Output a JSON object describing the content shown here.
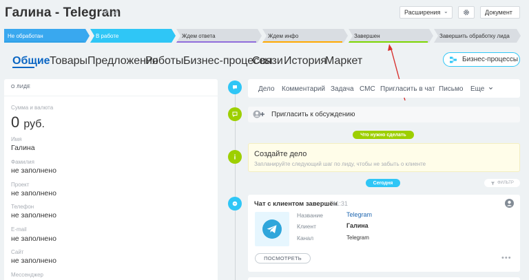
{
  "header": {
    "title": "Галина - Telegram",
    "extensions_label": "Расширения",
    "document_label": "Документ"
  },
  "stages": [
    {
      "label": "Не обработан",
      "color": "#39a8ef",
      "bar": "#2fa0e6"
    },
    {
      "label": "В работе",
      "color": "#2fc6f6",
      "bar": "#2fc6f6"
    },
    {
      "label": "Ждем ответа",
      "color": "#d9dde2",
      "bar": "#8f6cdb"
    },
    {
      "label": "Ждем инфо",
      "color": "#d9dde2",
      "bar": "#ffa900"
    },
    {
      "label": "Завершен",
      "color": "#d9dde2",
      "bar": "#7bd500"
    },
    {
      "label": "Завершить обработку лида",
      "color": "#d9dde2",
      "bar": "#d9dde2"
    }
  ],
  "tabs": [
    "Общие",
    "Товары",
    "Предложения",
    "Роботы",
    "Бизнес-процессы",
    "Связи",
    "История",
    "Маркет"
  ],
  "bp_button": "Бизнес-процессы",
  "lead": {
    "section_title": "О ЛИДЕ",
    "fields": [
      {
        "label": "Сумма и валюта",
        "value": "0",
        "unit": "руб."
      },
      {
        "label": "Имя",
        "value": "Галина"
      },
      {
        "label": "Фамилия",
        "value": "не заполнено"
      },
      {
        "label": "Проект",
        "value": "не заполнено"
      },
      {
        "label": "Телефон",
        "value": "не заполнено"
      },
      {
        "label": "E-mail",
        "value": "не заполнено"
      },
      {
        "label": "Сайт",
        "value": "не заполнено"
      },
      {
        "label": "Мессенджер",
        "value": ""
      }
    ]
  },
  "activity_menu": [
    "Дело",
    "Комментарий",
    "Задача",
    "СМС",
    "Пригласить в чат",
    "Письмо",
    "Еще"
  ],
  "invite": "Пригласить к обсуждению",
  "todo_pill": "Что нужно сделать",
  "create_task": {
    "title": "Создайте дело",
    "hint": "Запланируйте следующий шаг по лиду, чтобы не забыть о клиенте"
  },
  "today_pill": "Сегодня",
  "filter_label": "ФИЛЬТР",
  "chat": {
    "title": "Чат с клиентом завершён",
    "time": "11:31",
    "rows": [
      {
        "label": "Название",
        "value": "Telegram"
      },
      {
        "label": "Клиент",
        "value": "Галина"
      },
      {
        "label": "Канал",
        "value": "Telegram"
      }
    ],
    "view_button": "ПОСМОТРЕТЬ"
  }
}
